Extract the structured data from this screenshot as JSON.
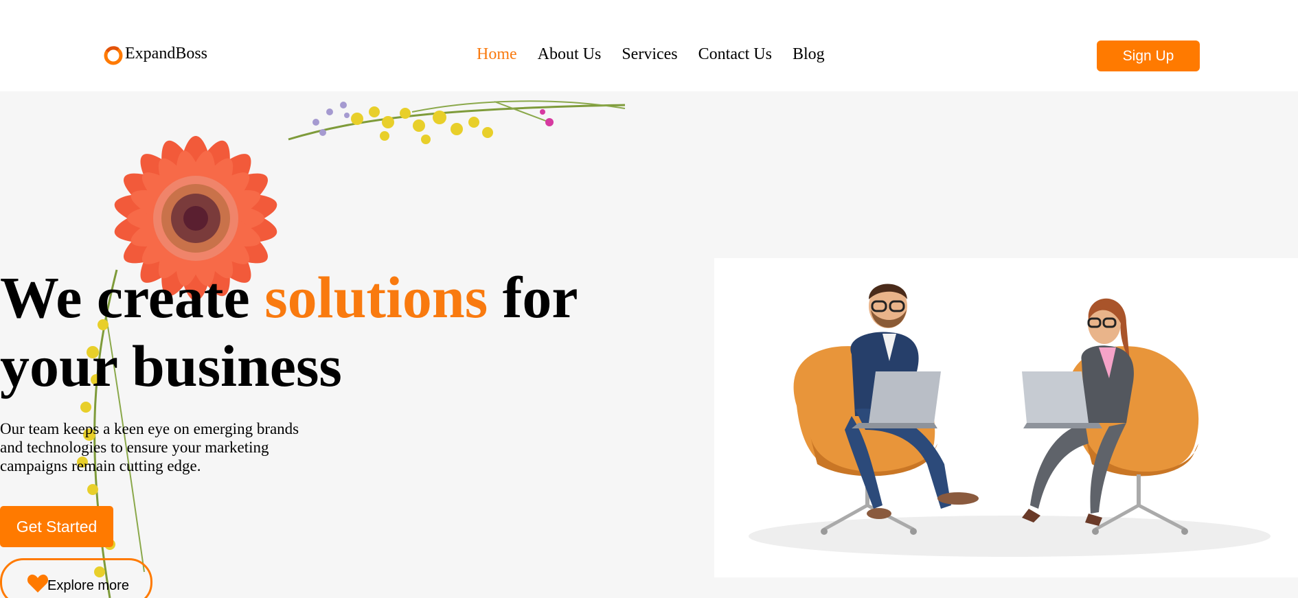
{
  "brand": {
    "name": "ExpandBoss",
    "accent_color": "#FF7A00"
  },
  "nav": {
    "items": [
      {
        "label": "Home",
        "active": true
      },
      {
        "label": "About Us",
        "active": false
      },
      {
        "label": "Services",
        "active": false
      },
      {
        "label": "Contact Us",
        "active": false
      },
      {
        "label": "Blog",
        "active": false
      }
    ],
    "signup_label": "Sign Up"
  },
  "hero": {
    "title_part1": "We create ",
    "title_accent": "solutions",
    "title_part2": " for your business",
    "description": "Our team keeps a keen eye on emerging brands and technologies to ensure your marketing campaigns remain cutting edge.",
    "primary_cta": "Get Started",
    "secondary_cta": "Explore more",
    "secondary_icon": "heart-icon"
  }
}
